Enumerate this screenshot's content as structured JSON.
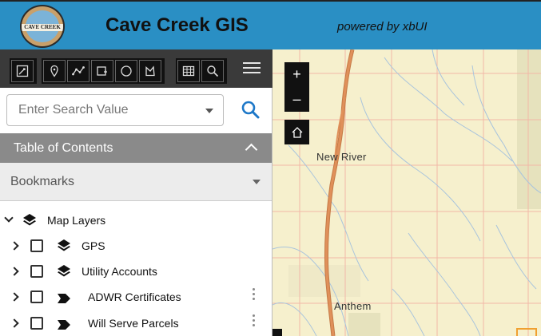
{
  "header": {
    "title": "Cave Creek GIS",
    "powered_by": "powered by xbUI",
    "logo_text": "CAVE CREEK"
  },
  "toolbar": {
    "groups": [
      [
        "edit-icon"
      ],
      [
        "point-icon",
        "polyline-icon",
        "polygon-icon",
        "circle-icon",
        "freehand-icon"
      ],
      [
        "table-icon",
        "search-icon"
      ]
    ],
    "menu_icon": "hamburger-icon"
  },
  "search": {
    "placeholder": "Enter Search Value"
  },
  "toc": {
    "title": "Table of Contents",
    "bookmarks_label": "Bookmarks",
    "root_label": "Map Layers",
    "layers": [
      {
        "label": "GPS",
        "icon": "layers-icon"
      },
      {
        "label": "Utility Accounts",
        "icon": "layers-icon"
      },
      {
        "label": "ADWR Certificates",
        "icon": "feature-layer-icon"
      },
      {
        "label": "Will Serve Parcels",
        "icon": "feature-layer-icon"
      }
    ]
  },
  "map": {
    "zoom_in": "+",
    "zoom_out": "–",
    "places": {
      "new_river": "New River",
      "anthem": "Anthem"
    },
    "colors": {
      "background": "#f6f0cd",
      "road": "#e0905a",
      "grid": "#f2b8a8",
      "streams": "#a9c4dc"
    }
  }
}
